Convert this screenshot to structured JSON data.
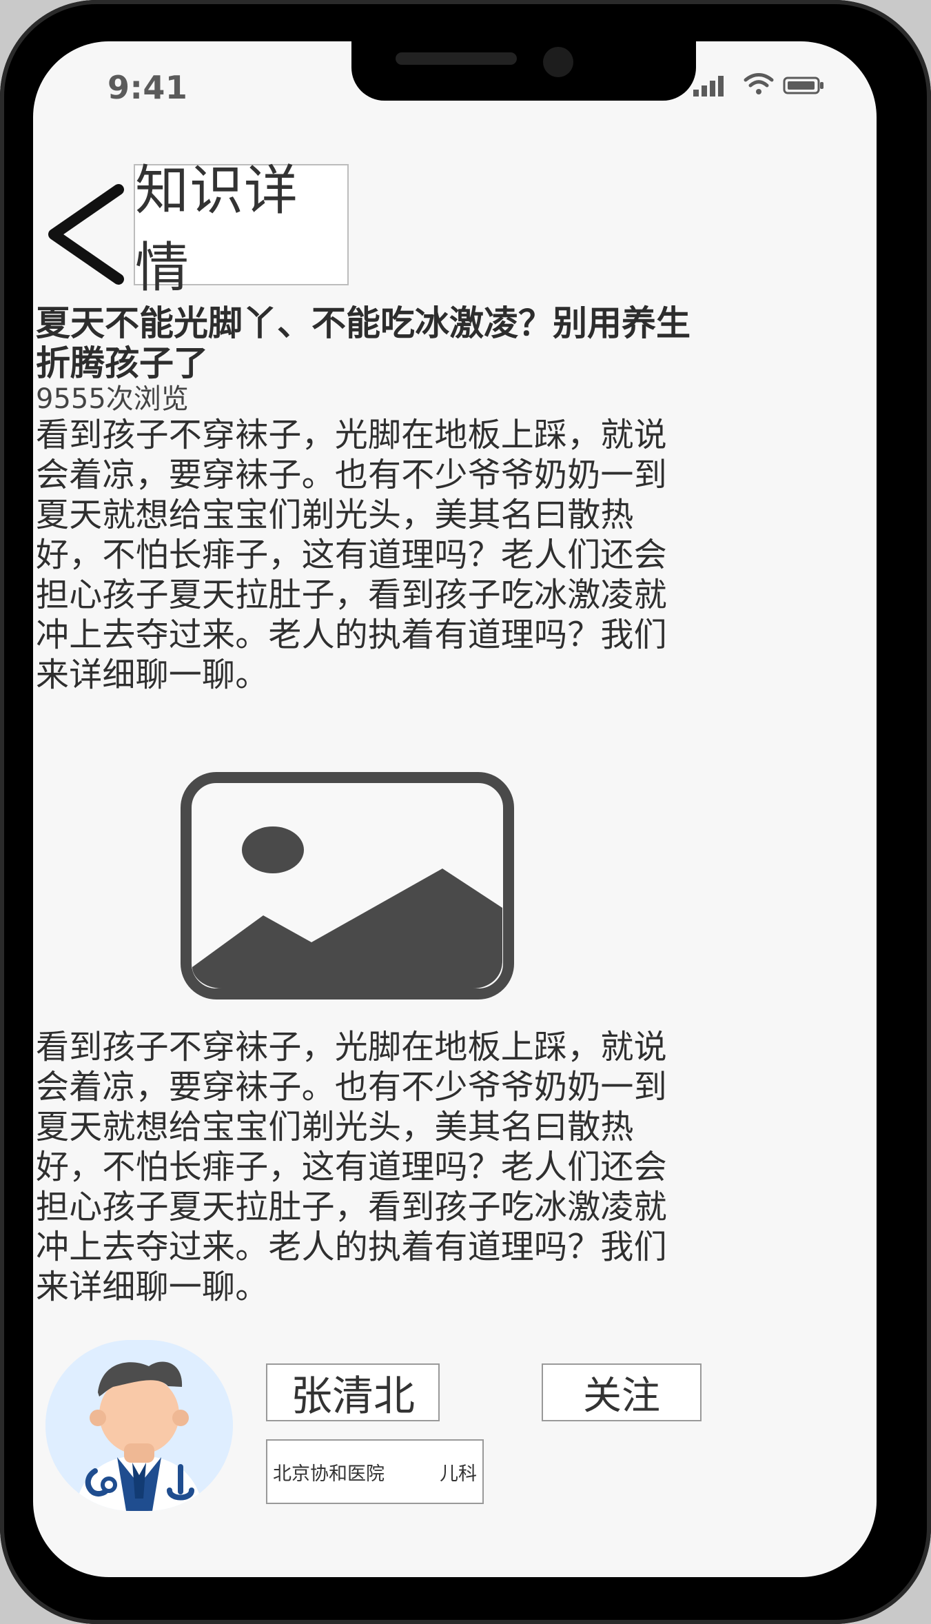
{
  "status_bar": {
    "time": "9:41",
    "signal_icon": "signal-icon",
    "wifi_icon": "wifi-icon",
    "battery_icon": "battery-icon"
  },
  "header": {
    "back_icon": "back-icon",
    "title": "知识详情"
  },
  "article": {
    "title": "夏天不能光脚丫、不能吃冰激凌？别用养生折腾孩子了",
    "views": "9555次浏览",
    "paragraph_1": "看到孩子不穿袜子，光脚在地板上踩，就说会着凉，要穿袜子。也有不少爷爷奶奶一到夏天就想给宝宝们剃光头，美其名曰散热好，不怕长痱子，这有道理吗？老人们还会担心孩子夏天拉肚子，看到孩子吃冰激凌就冲上去夺过来。老人的执着有道理吗？我们来详细聊一聊。",
    "image_placeholder_icon": "image-placeholder-icon",
    "paragraph_2": "看到孩子不穿袜子，光脚在地板上踩，就说会着凉，要穿袜子。也有不少爷爷奶奶一到夏天就想给宝宝们剃光头，美其名曰散热好，不怕长痱子，这有道理吗？老人们还会担心孩子夏天拉肚子，看到孩子吃冰激凌就冲上去夺过来。老人的执着有道理吗？我们来详细聊一聊。"
  },
  "author": {
    "avatar_icon": "doctor-avatar-icon",
    "name": "张清北",
    "follow_label": "关注",
    "hospital": "北京协和医院",
    "department": "儿科"
  },
  "colors": {
    "phone_frame": "#000000",
    "screen_bg": "#f7f7f7",
    "text": "#2f2f2f",
    "image_placeholder": "#4a4a4a",
    "avatar_bg": "#dfeeff",
    "doctor_blue": "#1f4d8f"
  }
}
